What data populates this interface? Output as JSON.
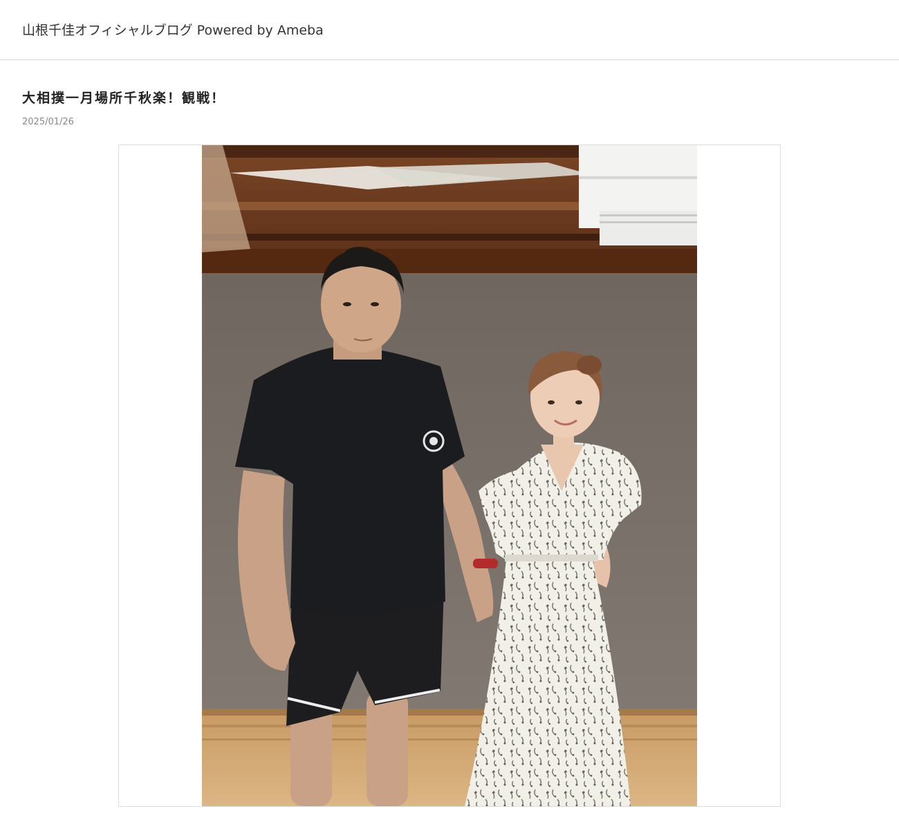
{
  "header": {
    "blog_title": "山根千佳オフィシャルブログ Powered by Ameba"
  },
  "entry": {
    "title": "大相撲一月場所千秋楽！観戦！",
    "date": "2025/01/26"
  },
  "colors": {
    "header_border": "#d8d8d8",
    "date_text": "#888888",
    "frame_border": "#dcdcdc"
  }
}
